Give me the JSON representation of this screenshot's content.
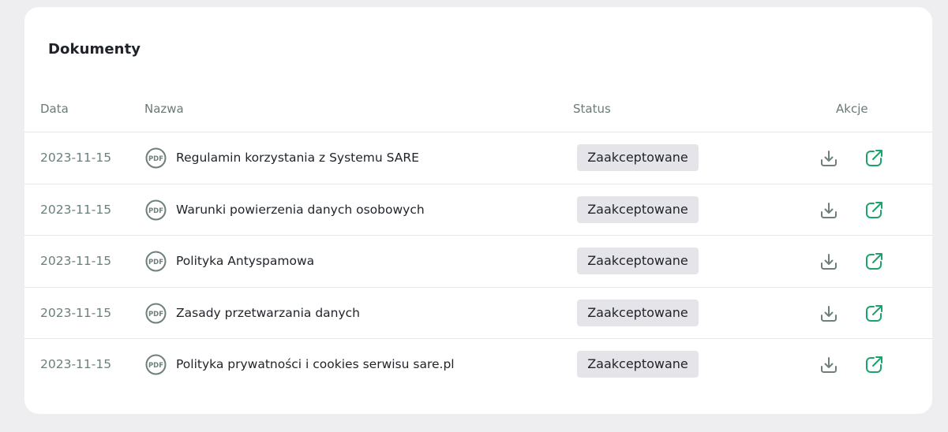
{
  "card": {
    "title": "Dokumenty"
  },
  "table": {
    "headers": {
      "date": "Data",
      "name": "Nazwa",
      "status": "Status",
      "actions": "Akcje"
    },
    "rows": [
      {
        "date": "2023-11-15",
        "file_icon": "pdf-icon",
        "name": "Regulamin korzystania z Systemu SARE",
        "status": "Zaakceptowane"
      },
      {
        "date": "2023-11-15",
        "file_icon": "pdf-icon",
        "name": "Warunki powierzenia danych osobowych",
        "status": "Zaakceptowane"
      },
      {
        "date": "2023-11-15",
        "file_icon": "pdf-icon",
        "name": "Polityka Antyspamowa",
        "status": "Zaakceptowane"
      },
      {
        "date": "2023-11-15",
        "file_icon": "pdf-icon",
        "name": "Zasady przetwarzania danych",
        "status": "Zaakceptowane"
      },
      {
        "date": "2023-11-15",
        "file_icon": "pdf-icon",
        "name": "Polityka prywatności i cookies serwisu sare.pl",
        "status": "Zaakceptowane"
      }
    ],
    "pdf_label": "PDF",
    "action_icons": [
      "download-icon",
      "external-link-icon"
    ]
  },
  "colors": {
    "page_background": "#eeeef1",
    "card_background": "#ffffff",
    "muted_text": "#6b7a78",
    "badge_background": "#e5e5e9",
    "download_icon": "#6e7f7c",
    "open_icon": "#1aa36b"
  }
}
